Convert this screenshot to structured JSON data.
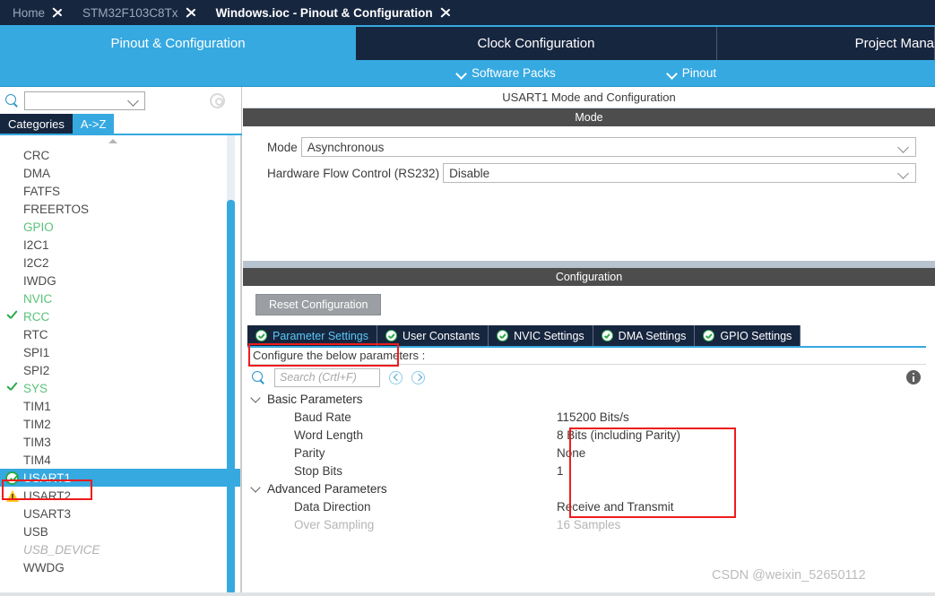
{
  "breadcrumb": {
    "items": [
      {
        "label": "Home",
        "active": false
      },
      {
        "label": "STM32F103C8Tx",
        "active": false
      },
      {
        "label": "Windows.ioc - Pinout & Configuration",
        "active": true
      }
    ]
  },
  "main_tabs": [
    {
      "label": "Pinout & Configuration",
      "active": true
    },
    {
      "label": "Clock Configuration",
      "active": false
    },
    {
      "label": "Project Mana",
      "active": false
    }
  ],
  "submenu": [
    {
      "label": "Software Packs",
      "icon": "chevron-down-icon"
    },
    {
      "label": "Pinout",
      "icon": "chevron-down-icon"
    }
  ],
  "sidebar": {
    "search": {
      "value": "",
      "placeholder": "",
      "icon": "search-icon"
    },
    "gear_icon": "gear-icon",
    "category_tabs": [
      {
        "label": "Categories",
        "active": false
      },
      {
        "label": "A->Z",
        "active": true
      }
    ],
    "items": [
      {
        "label": "CRC",
        "state": "normal",
        "icon": "none"
      },
      {
        "label": "DMA",
        "state": "normal",
        "icon": "none"
      },
      {
        "label": "FATFS",
        "state": "normal",
        "icon": "none"
      },
      {
        "label": "FREERTOS",
        "state": "normal",
        "icon": "none"
      },
      {
        "label": "GPIO",
        "state": "green",
        "icon": "none"
      },
      {
        "label": "I2C1",
        "state": "normal",
        "icon": "none"
      },
      {
        "label": "I2C2",
        "state": "normal",
        "icon": "none"
      },
      {
        "label": "IWDG",
        "state": "normal",
        "icon": "none"
      },
      {
        "label": "NVIC",
        "state": "green",
        "icon": "none"
      },
      {
        "label": "RCC",
        "state": "green",
        "icon": "check-icon"
      },
      {
        "label": "RTC",
        "state": "normal",
        "icon": "none"
      },
      {
        "label": "SPI1",
        "state": "normal",
        "icon": "none"
      },
      {
        "label": "SPI2",
        "state": "normal",
        "icon": "none"
      },
      {
        "label": "SYS",
        "state": "green",
        "icon": "check-icon"
      },
      {
        "label": "TIM1",
        "state": "normal",
        "icon": "none"
      },
      {
        "label": "TIM2",
        "state": "normal",
        "icon": "none"
      },
      {
        "label": "TIM3",
        "state": "normal",
        "icon": "none"
      },
      {
        "label": "TIM4",
        "state": "normal",
        "icon": "none"
      },
      {
        "label": "USART1",
        "state": "selected",
        "icon": "check-circle-icon"
      },
      {
        "label": "USART2",
        "state": "normal",
        "icon": "warning-icon"
      },
      {
        "label": "USART3",
        "state": "normal",
        "icon": "none"
      },
      {
        "label": "USB",
        "state": "normal",
        "icon": "none"
      },
      {
        "label": "USB_DEVICE",
        "state": "dim",
        "icon": "none"
      },
      {
        "label": "WWDG",
        "state": "normal",
        "icon": "none"
      }
    ]
  },
  "panel": {
    "title": "USART1 Mode and Configuration",
    "mode_section": {
      "header": "Mode",
      "fields": [
        {
          "label": "Mode",
          "value": "Asynchronous"
        },
        {
          "label": "Hardware Flow Control (RS232)",
          "value": "Disable"
        }
      ]
    },
    "configuration_section": {
      "header": "Configuration",
      "reset_button": "Reset Configuration",
      "tabs": [
        {
          "label": "Parameter Settings",
          "active": true
        },
        {
          "label": "User Constants",
          "active": false
        },
        {
          "label": "NVIC Settings",
          "active": false
        },
        {
          "label": "DMA Settings",
          "active": false
        },
        {
          "label": "GPIO Settings",
          "active": false
        }
      ],
      "hint": "Configure the below parameters :",
      "search": {
        "placeholder": "Search (Crtl+F)",
        "icon": "search-icon"
      },
      "nav_prev_icon": "circle-chevron-left-icon",
      "nav_next_icon": "circle-chevron-right-icon",
      "info_icon": "info-icon",
      "groups": [
        {
          "label": "Basic Parameters",
          "expanded": true,
          "rows": [
            {
              "name": "Baud Rate",
              "value": "115200 Bits/s",
              "dim": false
            },
            {
              "name": "Word Length",
              "value": "8 Bits (including Parity)",
              "dim": false
            },
            {
              "name": "Parity",
              "value": "None",
              "dim": false
            },
            {
              "name": "Stop Bits",
              "value": "1",
              "dim": false
            }
          ]
        },
        {
          "label": "Advanced Parameters",
          "expanded": true,
          "rows": [
            {
              "name": "Data Direction",
              "value": "Receive and Transmit",
              "dim": false
            },
            {
              "name": "Over Sampling",
              "value": "16 Samples",
              "dim": true
            }
          ]
        }
      ]
    }
  },
  "watermark": "CSDN @weixin_52650112",
  "colors": {
    "accent_blue": "#36a9e1",
    "dark_navy": "#17263f",
    "section_gray": "#4d4d4d",
    "green": "#2aa84a",
    "annotation_red": "#ee1c1c",
    "warning_yellow": "#ffc61a"
  }
}
